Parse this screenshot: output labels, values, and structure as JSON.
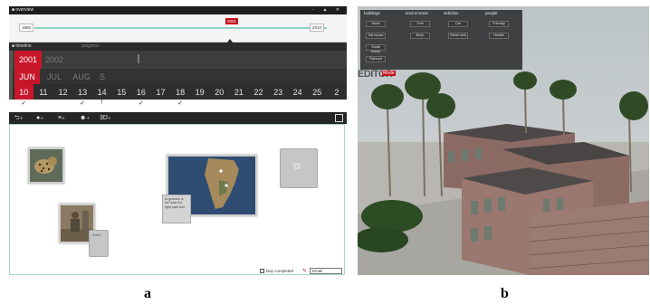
{
  "panel_a": {
    "titlebar": {
      "title": "overview",
      "ctrls": "- ▲ ✕"
    },
    "overview": {
      "start_year": "1980",
      "end_year": "2010",
      "current_year": "2001"
    },
    "timeline": {
      "label": "timeline",
      "progress_label": "progress"
    },
    "years": [
      "2001",
      "2002"
    ],
    "months": [
      "JUN",
      "JUL",
      "AUG",
      "S"
    ],
    "days": [
      "10",
      "11",
      "12",
      "13",
      "14",
      "15",
      "16",
      "17",
      "18",
      "19",
      "20",
      "21",
      "22",
      "23",
      "24",
      "25",
      "2"
    ],
    "marks": [
      {
        "day": "10",
        "glyph": "✓"
      },
      {
        "day": "13",
        "glyph": "✓"
      },
      {
        "day": "14",
        "glyph": "!"
      },
      {
        "day": "16",
        "glyph": "✓"
      },
      {
        "day": "18",
        "glyph": "✓"
      }
    ],
    "toolbar": [
      "⮌₊",
      "●₊",
      "≡₊",
      "☻₊",
      "3D₊"
    ],
    "note_text": "Ai grasses is, we have the right path and",
    "sheet_label": "Sheet",
    "day_completed_label": "Day completed",
    "email_value": "Email"
  },
  "panel_b": {
    "categories": [
      "buildings",
      "environment",
      "vehicles",
      "people"
    ],
    "buttons": {
      "buildings": [
        "Hotel",
        "Tall house",
        "Small house",
        "Planned"
      ],
      "environment": [
        "Tree",
        "Bush"
      ],
      "vehicles": [
        "Car",
        "Street sink"
      ],
      "people": [
        "Friendly",
        "Hostile"
      ]
    },
    "editor_label": "EDITOR",
    "editor_badge": "Mode"
  },
  "labels": {
    "a": "a",
    "b": "b"
  },
  "colors": {
    "accent_red": "#c8172a",
    "teal_line": "#8fd0c4",
    "dark_bar": "#262626"
  }
}
